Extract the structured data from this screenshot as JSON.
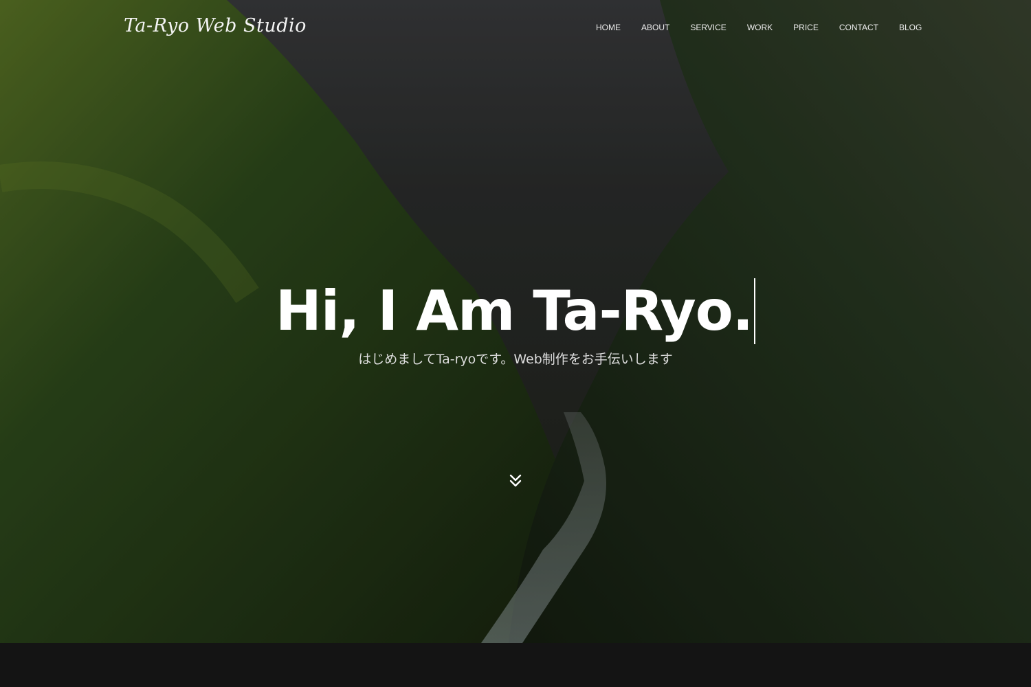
{
  "header": {
    "logo": "Ta-Ryo Web Studio",
    "nav": [
      "HOME",
      "ABOUT",
      "SERVICE",
      "WORK",
      "PRICE",
      "CONTACT",
      "BLOG"
    ]
  },
  "hero": {
    "headline": "Hi, I Am Ta-Ryo.",
    "subtitle": "はじめましてTa-ryoです。Web制作をお手伝いします",
    "scroll_icon": "double-chevron-down-icon"
  },
  "colors": {
    "text": "#ffffff",
    "footer_band": "#141414"
  }
}
